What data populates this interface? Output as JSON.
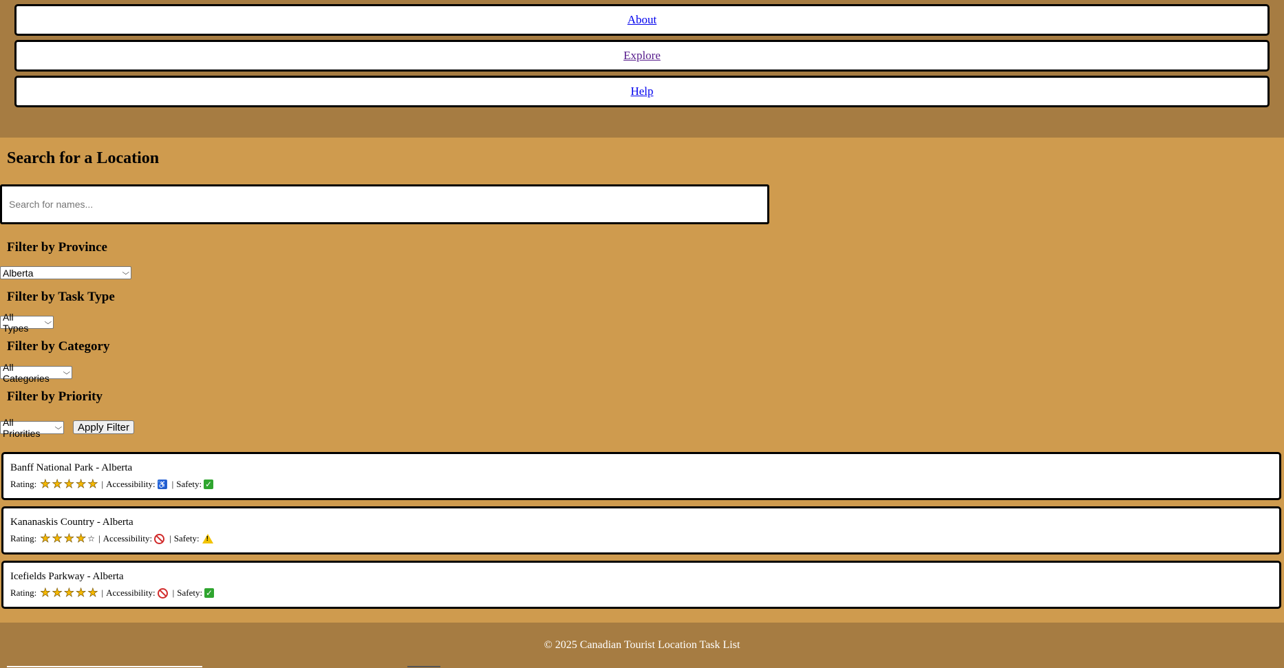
{
  "nav": {
    "about": "About",
    "explore": "Explore",
    "help": "Help"
  },
  "search": {
    "title": "Search for a Location",
    "placeholder": "Search for names..."
  },
  "filters": {
    "province_title": "Filter by Province",
    "province_value": "Alberta",
    "task_type_title": "Filter by Task Type",
    "task_type_value": "All Types",
    "category_title": "Filter by Category",
    "category_value": "All Categories",
    "priority_title": "Filter by Priority",
    "priority_value": "All Priorities",
    "apply_label": "Apply Filter"
  },
  "labels": {
    "rating": "Rating:",
    "accessibility": "Accessibility:",
    "safety": "Safety:",
    "separator": "|"
  },
  "locations": [
    {
      "name": "Banff National Park - Alberta",
      "rating": 5,
      "accessibility": "accessible",
      "safety": "safe"
    },
    {
      "name": "Kananaskis Country - Alberta",
      "rating": 4,
      "accessibility": "not-accessible",
      "safety": "warning"
    },
    {
      "name": "Icefields Parkway - Alberta",
      "rating": 5,
      "accessibility": "not-accessible",
      "safety": "safe"
    }
  ],
  "footer": {
    "text": "© 2025 Canadian Tourist Location Task List"
  },
  "colors": {
    "header_bg": "#a67c42",
    "page_bg": "#cf9b4e",
    "link": "#0000ee",
    "visited_link": "#551a8b"
  }
}
